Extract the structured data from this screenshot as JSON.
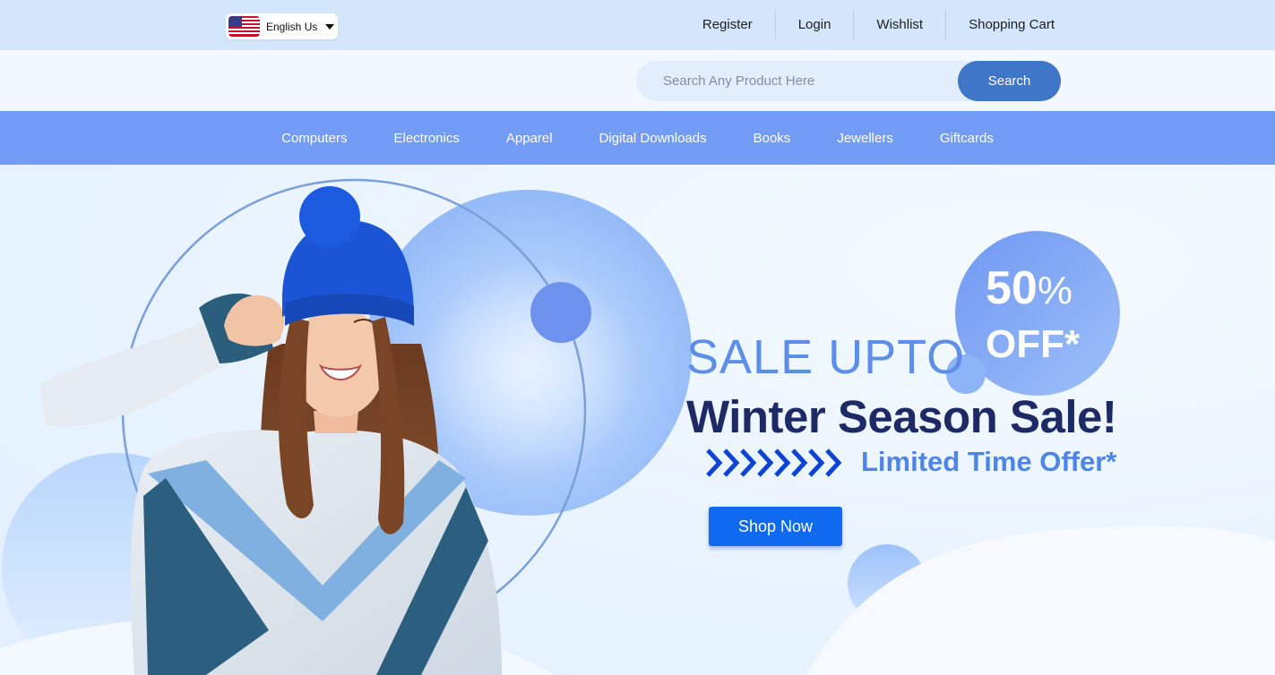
{
  "language": {
    "label": "English Us",
    "flag_icon": "us-flag-icon"
  },
  "top_links": [
    "Register",
    "Login",
    "Wishlist",
    "Shopping Cart"
  ],
  "search": {
    "placeholder": "Search Any Product Here",
    "button_label": "Search"
  },
  "nav": [
    "Computers",
    "Electronics",
    "Apparel",
    "Digital Downloads",
    "Books",
    "Jewellers",
    "Giftcards"
  ],
  "hero": {
    "sale_upto": "SALE UPTO",
    "headline": "Winter Season Sale!",
    "limited": "Limited Time Offer*",
    "cta": "Shop Now",
    "badge_number": "50",
    "badge_symbol": "%",
    "badge_off": "OFF*"
  },
  "colors": {
    "topbar": "#d3e6fb",
    "nav": "#729cf6",
    "search_button": "#3f76c7",
    "cta": "#0f6af0",
    "headline": "#1e2a66",
    "accent": "#4f86e6"
  }
}
